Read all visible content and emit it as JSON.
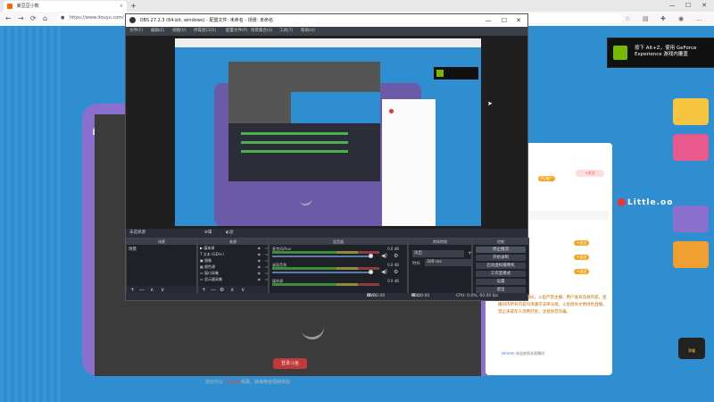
{
  "browser": {
    "tab_title": "暴豆豆小熊",
    "url": "https://www.douyu.com/",
    "new_tab": "+",
    "nav_back": "←",
    "nav_forward": "→",
    "nav_reload": "⟳",
    "nav_home": "⌂",
    "tab_close": "×",
    "win_min": "—",
    "win_max": "☐",
    "win_close": "✕",
    "lock": "🔒"
  },
  "site": {
    "video_button": "登录斗鱼",
    "video_note_prefix": "您还可以",
    "video_note_link": "下载斗鱼",
    "video_note_suffix": "观看，获得绝佳视频体验",
    "badge_number": "12",
    "badge_sub": "贡献周榜",
    "avatar_name": "暴豆豆",
    "chat_tabs": [
      "粉丝",
      "周榜"
    ],
    "chat_pill": "PC推广",
    "chat_rows": [
      "斗鱼用户",
      "+关注",
      "+关注",
      "+关注"
    ],
    "chat_block": "欢迎来到斗鱼直播间，斗鱼严禁主播、用户发布违规内容，直播间内所有内容均须遵守法律法规。斗鱼倡导文明绿色直播，禁止未成年人消费打赏，注意防范诈骗。",
    "chat_sys_user": "Hmmm",
    "chat_sys_text": "欢迎来到本直播间",
    "pink_button": "+关注",
    "handle": "Little.oo",
    "tiktok_icon": "♪",
    "rail_badge": "荣耀",
    "header_brand": "斗鱼"
  },
  "nvidia": {
    "text": "按下 Alt+Z，使用 GeForce Experience 游戏内覆盖"
  },
  "obs": {
    "title": "OBS 27.2.3 (64-bit, windows) - 配置文件: 未命名 - 场景: 未命名",
    "menu": [
      "文件(F)",
      "编辑(E)",
      "视图(V)",
      "停靠窗口(D)",
      "配置文件(P)",
      "场景集合(S)",
      "工具(T)",
      "帮助(H)"
    ],
    "scene_bar_label": "未选择源",
    "scene_bar_props": "属性",
    "scene_bar_filters": "滤镜",
    "docks": {
      "scenes_title": "场景",
      "sources_title": "来源",
      "mixer_title": "混音器",
      "transitions_title": "转场特效",
      "controls_title": "控制"
    },
    "scenes": [
      "场景"
    ],
    "sources": [
      "媒体源",
      "文本 (GDI+)",
      "图像",
      "颜色源",
      "窗口采集",
      "显示器采集"
    ],
    "mixer": [
      {
        "name": "麦克风/Aux",
        "db": "0.0 dB",
        "level": 0.0
      },
      {
        "name": "桌面音频",
        "db": "0.0 dB",
        "level": 0.0
      },
      {
        "name": "媒体源",
        "db": "0.0 dB",
        "level": 0.0
      }
    ],
    "transition": "淡出",
    "duration_label": "时长",
    "duration_value": "300 ms",
    "controls": [
      "停止推流",
      "开始录制",
      "启动虚拟摄像机",
      "工作室模式",
      "设置",
      "退出"
    ],
    "status": {
      "live_label": "LIVE:",
      "live_time": "00:00:00",
      "rec_label": "REC:",
      "rec_time": "00:00:00",
      "cpu": "CPU: 0.0%, 60.00 fps"
    },
    "foot_add": "+",
    "foot_remove": "—",
    "foot_up": "∧",
    "foot_down": "∨",
    "foot_gear": "⚙",
    "vol_icon": "🔊",
    "gear_icon": "⚙"
  },
  "icons": {
    "eye": "👁",
    "lock": "🔒"
  }
}
